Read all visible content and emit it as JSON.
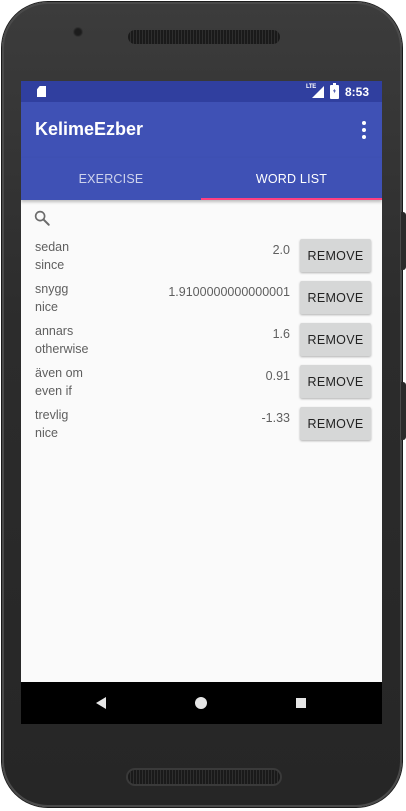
{
  "status_bar": {
    "network": "LTE",
    "time": "8:53"
  },
  "app_bar": {
    "title": "KelimeEzber"
  },
  "tabs": [
    {
      "label": "EXERCISE",
      "active": false
    },
    {
      "label": "WORD LIST",
      "active": true
    }
  ],
  "word_list": [
    {
      "word": "sedan",
      "translation": "since",
      "score": "2.0",
      "button": "REMOVE"
    },
    {
      "word": "snygg",
      "translation": "nice",
      "score": "1.9100000000000001",
      "button": "REMOVE"
    },
    {
      "word": "annars",
      "translation": "otherwise",
      "score": "1.6",
      "button": "REMOVE"
    },
    {
      "word": "även om",
      "translation": "even if",
      "score": "0.91",
      "button": "REMOVE"
    },
    {
      "word": "trevlig",
      "translation": "nice",
      "score": "-1.33",
      "button": "REMOVE"
    }
  ],
  "colors": {
    "primary": "#3f51b5",
    "primary_dark": "#303f9f",
    "accent": "#ff4081",
    "background": "#fafafa",
    "button": "#d6d7d7"
  },
  "icons": {
    "search": "search-icon",
    "overflow": "more-vert-icon",
    "back": "back-icon",
    "home": "home-icon",
    "recents": "recents-icon"
  }
}
